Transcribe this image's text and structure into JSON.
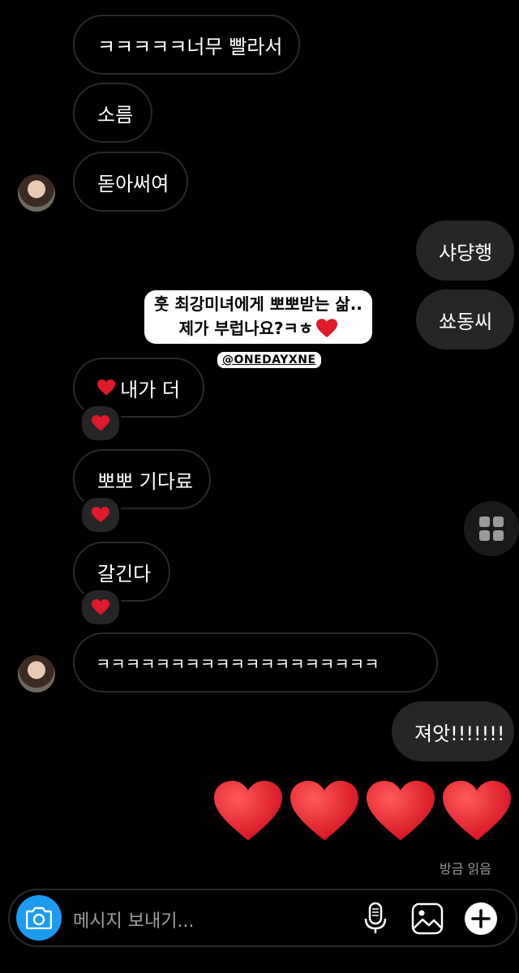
{
  "messages": {
    "m1": "ㅋㅋㅋㅋㅋ너무 빨라서",
    "m2": "소름",
    "m3": "돋아써여",
    "m4": "샤댱행",
    "m5": "쑈동씨",
    "m6": "내가 더",
    "m7": "뽀뽀 기다료",
    "m8": "갈긴다",
    "m9": "ㅋㅋㅋㅋㅋㅋㅋㅋㅋㅋㅋㅋㅋㅋㅋㅋㅋㅋㅋ",
    "m10": "져앗!!!!!!!"
  },
  "story": {
    "line1": "훗 최강미녀에게 뽀뽀받는 삶..",
    "line2": "제가 부럽나요?ㅋㅎ",
    "tag": "@ONEDAYXNE"
  },
  "status": {
    "seen": "방금 읽음"
  },
  "composer": {
    "placeholder": "메시지 보내기..."
  },
  "colors": {
    "background": "#000000",
    "incoming_border": "#2a2a2a",
    "outgoing_bubble": "#262626",
    "camera": "#1d9bf0",
    "heart": "#e0192b"
  },
  "icons": [
    "camera-icon",
    "microphone-icon",
    "image-icon",
    "plus-icon",
    "grid-icon",
    "heart-icon"
  ]
}
